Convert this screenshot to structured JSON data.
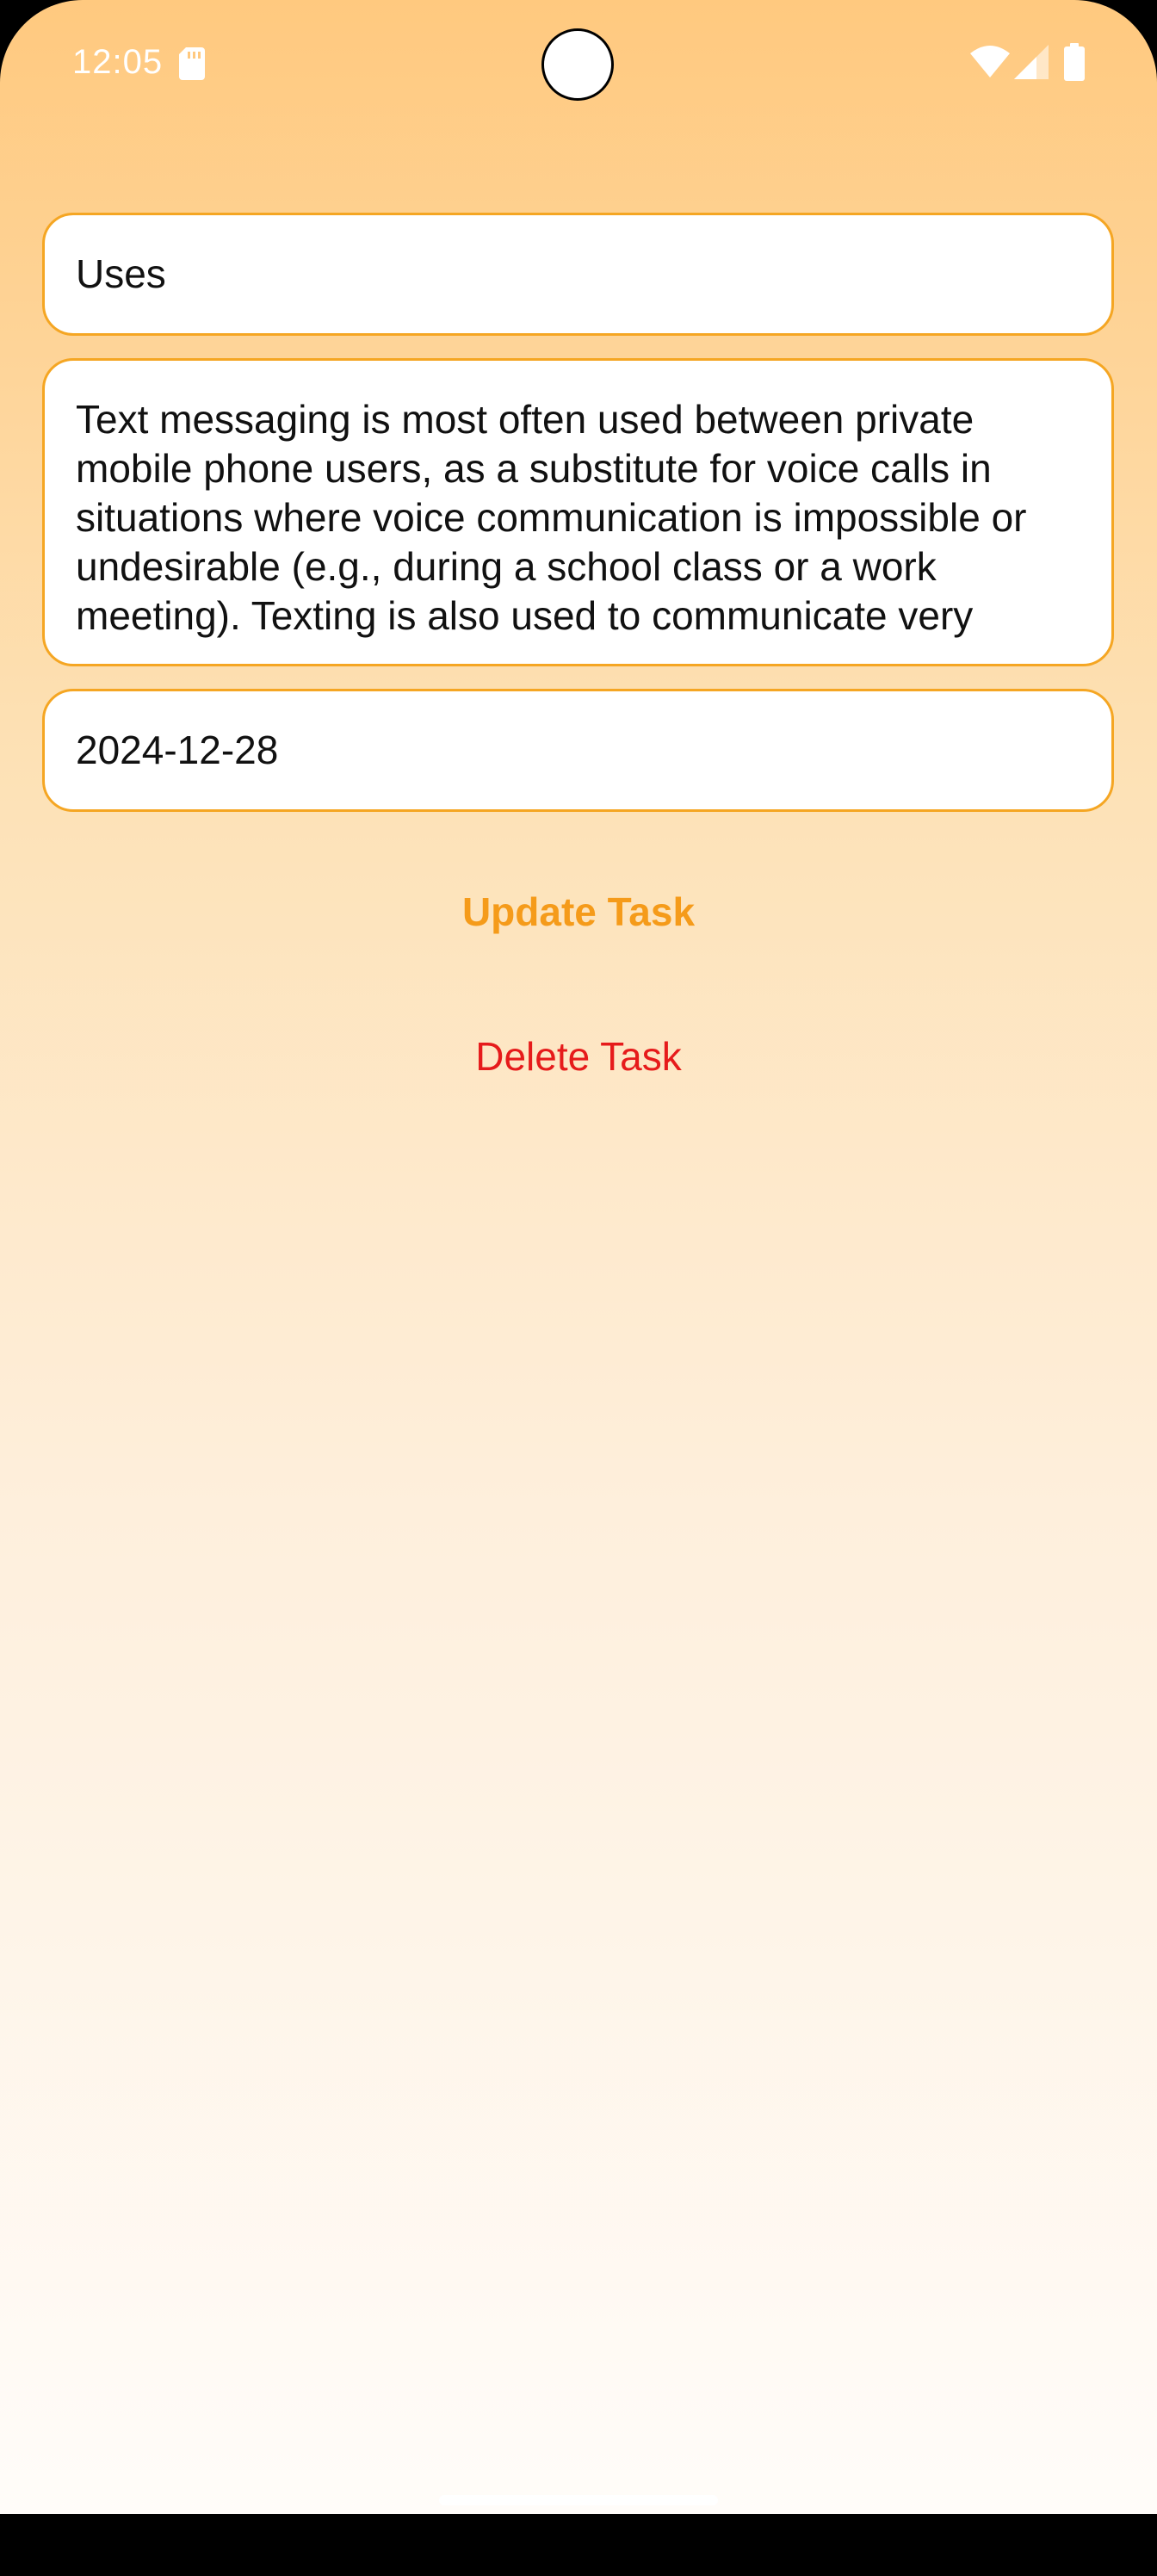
{
  "status_bar": {
    "time": "12:05",
    "icons": [
      "sd-card-icon",
      "wifi-icon",
      "cellular-signal-icon",
      "battery-icon"
    ]
  },
  "form": {
    "title_value": "Uses",
    "description_lines": [
      "Text messaging is most often used between private",
      "mobile phone users, as a substitute for voice calls in",
      "situations where voice communication is impossible or",
      "undesirable (e.g., during a school class or a work",
      "meeting). Texting is also used to communicate very"
    ],
    "date_value": "2024-12-28"
  },
  "actions": {
    "update_label": "Update Task",
    "delete_label": "Delete Task"
  },
  "colors": {
    "accent": "#f59b1a",
    "field_border": "#f5a623",
    "danger": "#e61b1b",
    "gradient_top": "#ffc97f",
    "gradient_bottom": "#fffcf9"
  }
}
